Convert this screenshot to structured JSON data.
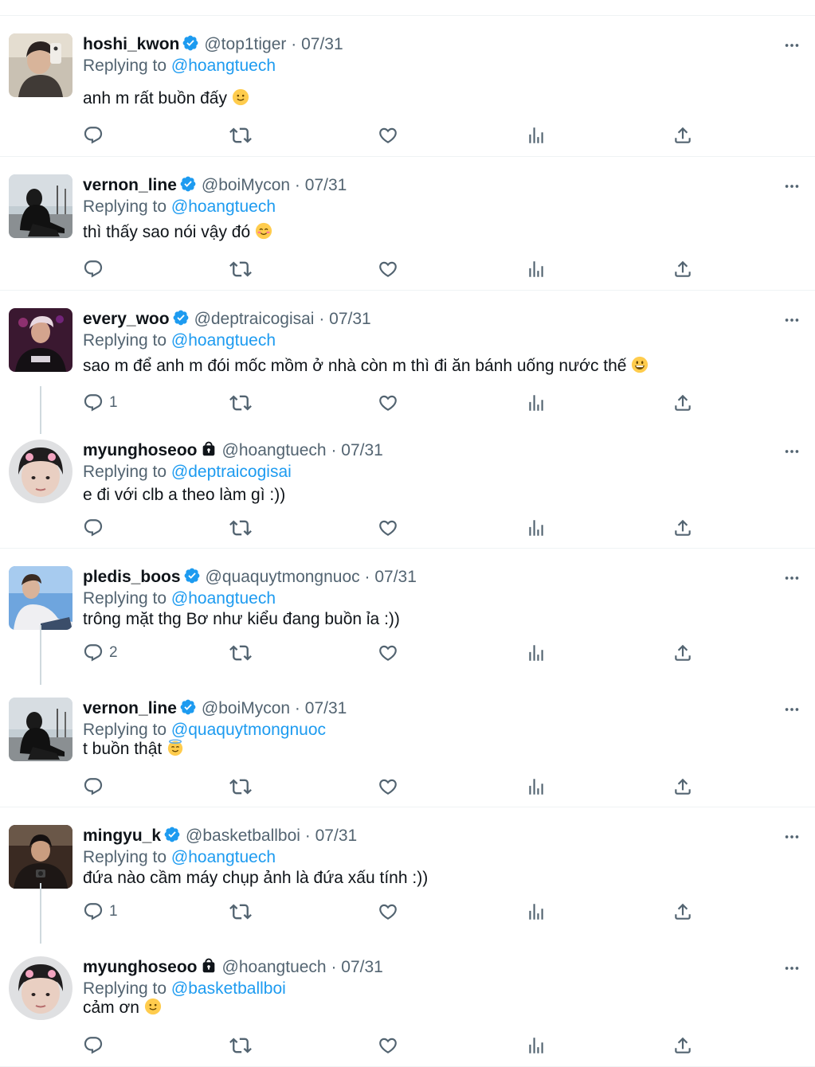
{
  "colors": {
    "accent": "#1d9bf0",
    "muted": "#536471",
    "text": "#0f1419",
    "divider": "#eff3f4"
  },
  "tweets": [
    {
      "avatar": "avatar-photo-1",
      "name": "hoshi_kwon",
      "badge": "verified",
      "handle": "@top1tiger",
      "sep": "·",
      "date": "07/31",
      "replying_label": "Replying to",
      "replying_to": "@hoangtuech",
      "text": "anh m rất buồn đấy",
      "emoji": "slightly-smiling-face",
      "reply_count": "",
      "thread_below": false
    },
    {
      "avatar": "avatar-photo-2",
      "name": "vernon_line",
      "badge": "verified",
      "handle": "@boiMycon",
      "sep": "·",
      "date": "07/31",
      "replying_label": "Replying to",
      "replying_to": "@hoangtuech",
      "text": "thì thấy sao nói vậy đó",
      "emoji": "smiling-face-with-smiling-eyes",
      "reply_count": "",
      "thread_below": false
    },
    {
      "avatar": "avatar-photo-3",
      "name": "every_woo",
      "badge": "verified",
      "handle": "@deptraicogisai",
      "sep": "·",
      "date": "07/31",
      "replying_label": "Replying to",
      "replying_to": "@hoangtuech",
      "text": "sao m để anh m đói mốc mồm ở nhà còn m thì đi ăn bánh uống nước thế",
      "emoji": "grinning-face",
      "reply_count": "1",
      "thread_below": true
    },
    {
      "avatar": "avatar-photo-4",
      "name": "myunghoseoo",
      "badge": "protected",
      "handle": "@hoangtuech",
      "sep": "·",
      "date": "07/31",
      "replying_label": "Replying to",
      "replying_to": "@deptraicogisai",
      "text": "e đi với clb a theo làm gì :))",
      "emoji": "",
      "reply_count": "",
      "thread_below": false
    },
    {
      "avatar": "avatar-photo-5",
      "name": "pledis_boos",
      "badge": "verified",
      "handle": "@quaquytmongnuoc",
      "sep": "·",
      "date": "07/31",
      "replying_label": "Replying to",
      "replying_to": "@hoangtuech",
      "text": "trông mặt thg Bơ như kiểu đang buồn ỉa :))",
      "emoji": "",
      "reply_count": "2",
      "thread_below": true
    },
    {
      "avatar": "avatar-photo-2",
      "name": "vernon_line",
      "badge": "verified",
      "handle": "@boiMycon",
      "sep": "·",
      "date": "07/31",
      "replying_label": "Replying to",
      "replying_to": "@quaquytmongnuoc",
      "text": "t buồn thật",
      "emoji": "smiling-face-with-halo",
      "reply_count": "",
      "thread_below": false
    },
    {
      "avatar": "avatar-photo-6",
      "name": "mingyu_k",
      "badge": "verified",
      "handle": "@basketballboi",
      "sep": "·",
      "date": "07/31",
      "replying_label": "Replying to",
      "replying_to": "@hoangtuech",
      "text": "đứa nào cầm máy chụp ảnh là đứa xấu tính :))",
      "emoji": "",
      "reply_count": "1",
      "thread_below": true
    },
    {
      "avatar": "avatar-photo-4",
      "name": "myunghoseoo",
      "badge": "protected",
      "handle": "@hoangtuech",
      "sep": "·",
      "date": "07/31",
      "replying_label": "Replying to",
      "replying_to": "@basketballboi",
      "text": "cảm ơn",
      "emoji": "slightly-smiling-face",
      "reply_count": "",
      "thread_below": false
    }
  ]
}
